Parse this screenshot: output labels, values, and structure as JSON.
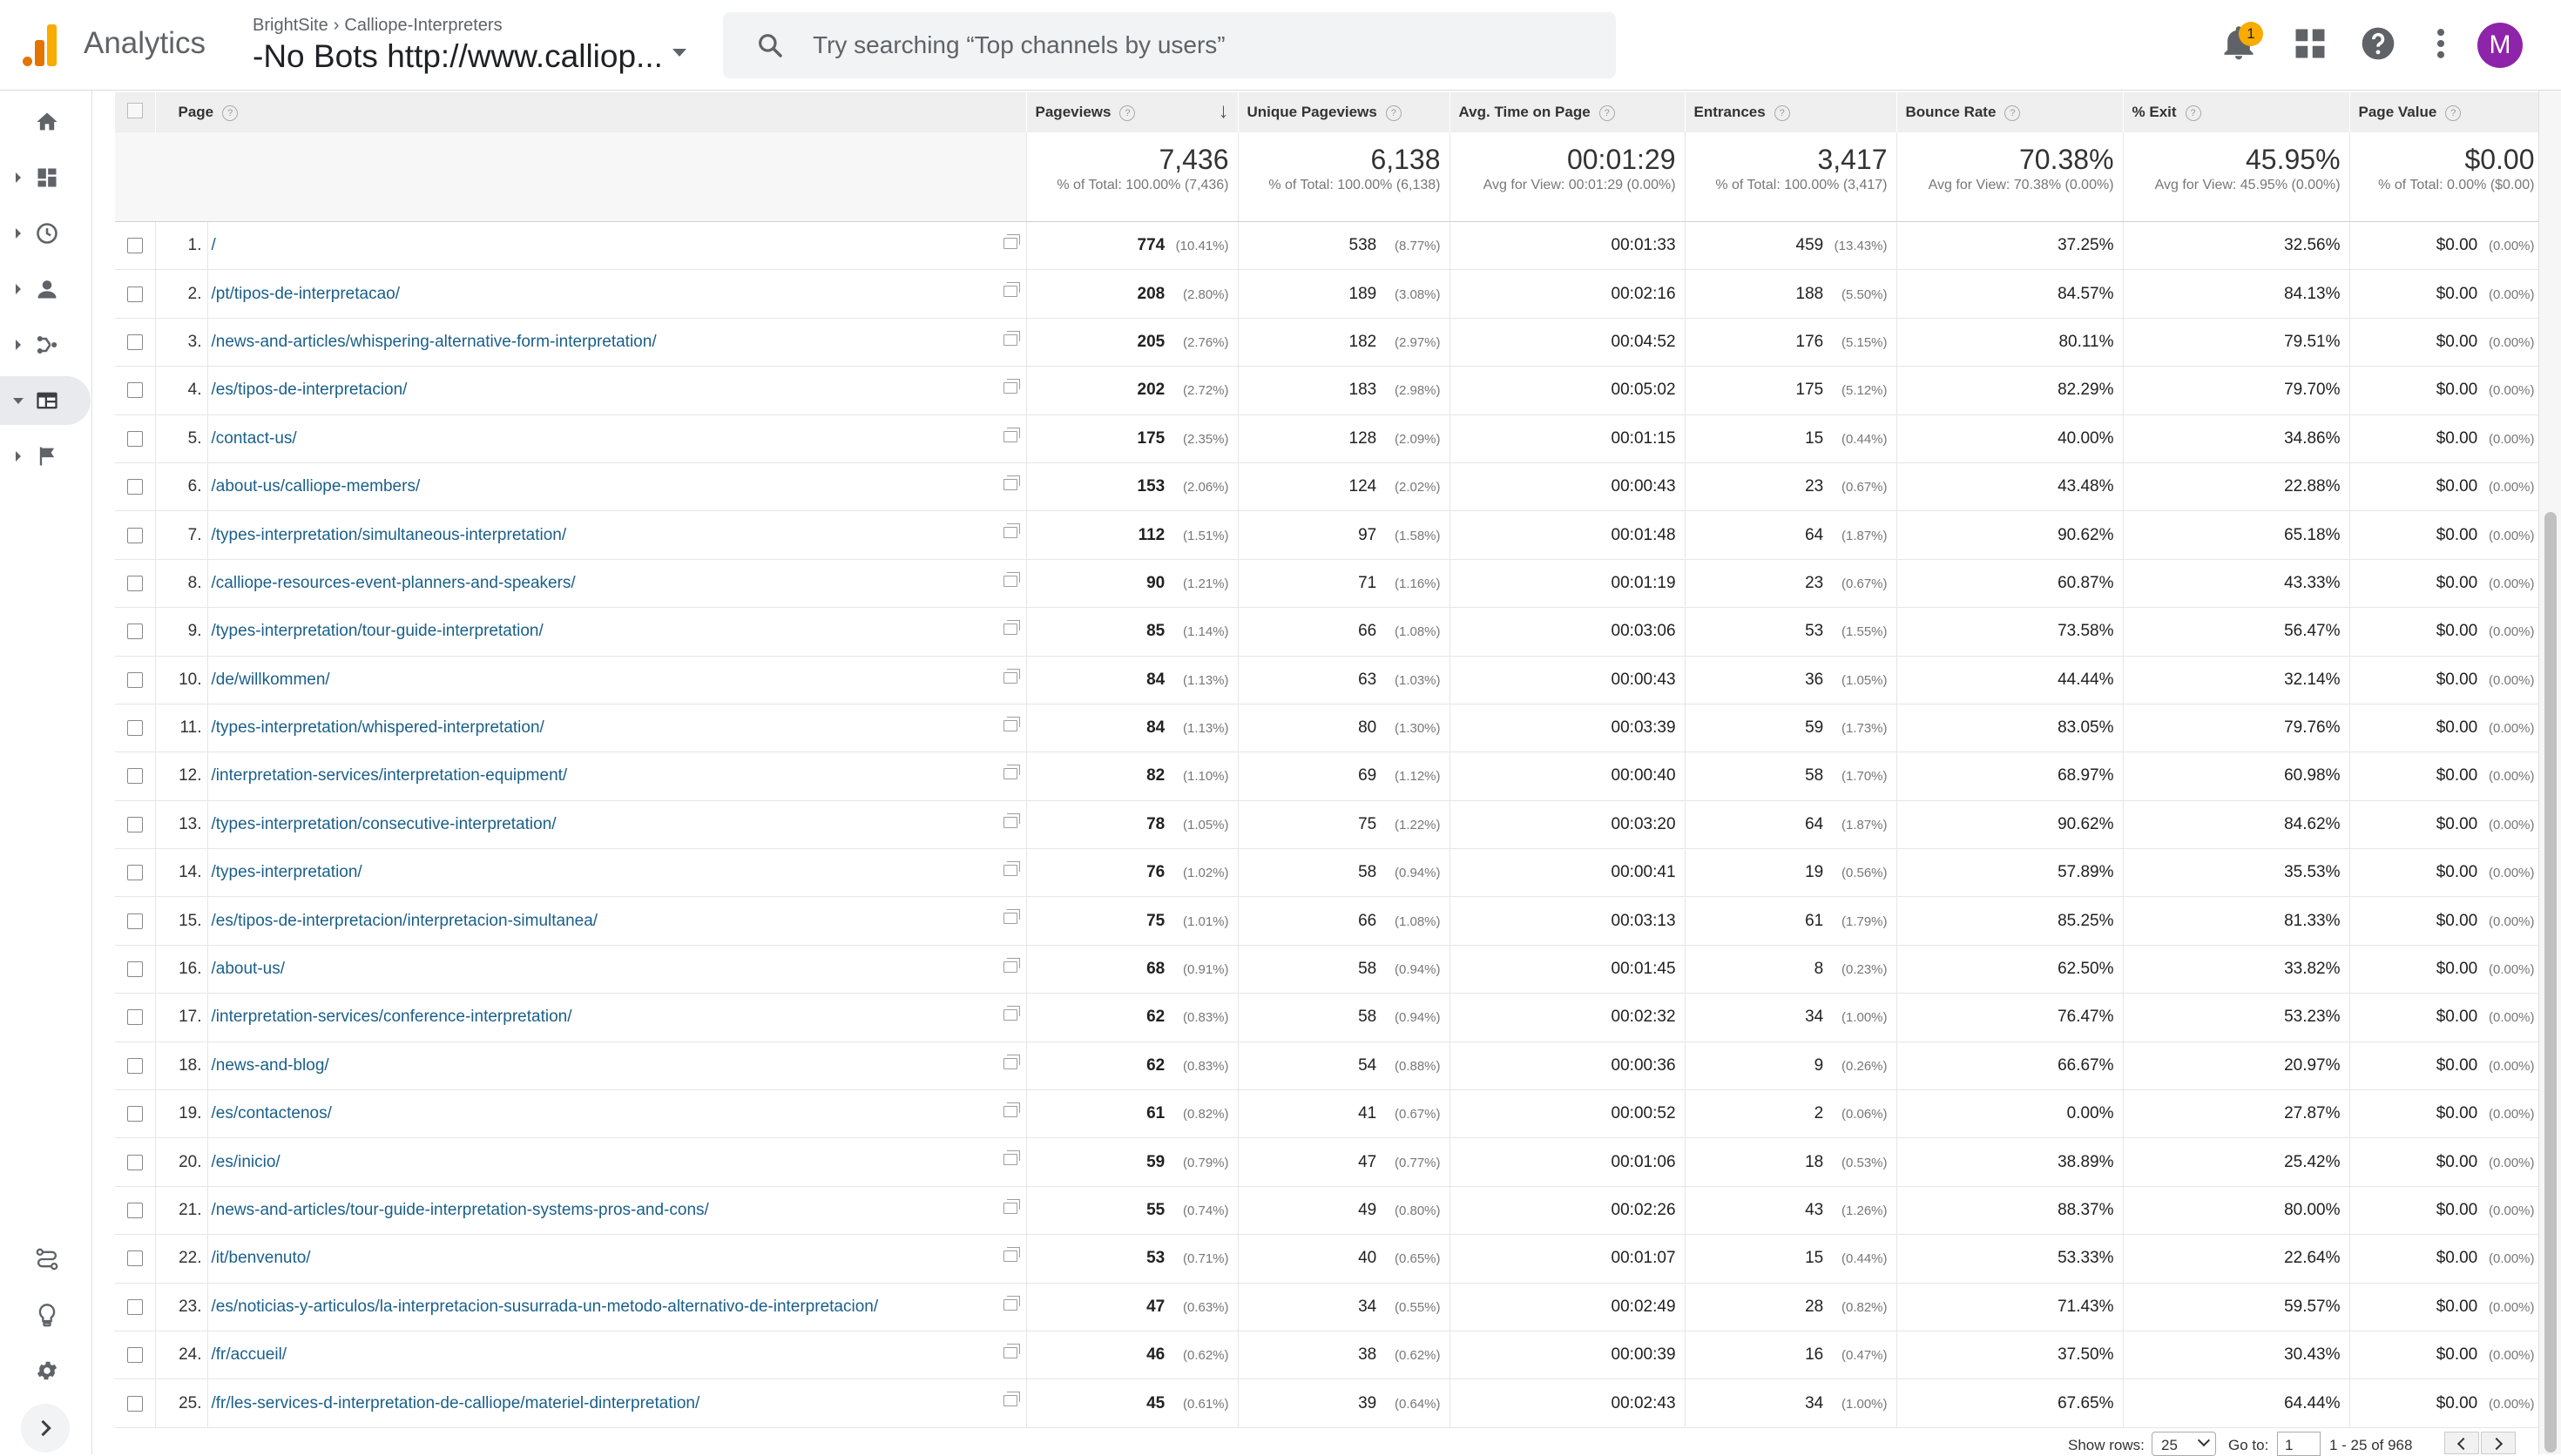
{
  "header": {
    "app_name": "Analytics",
    "account": "BrightSite",
    "property": "Calliope-Interpreters",
    "view": "-No Bots http://www.calliop...",
    "search_placeholder": "Try searching “Top channels by users”",
    "notification_count": "1",
    "avatar_letter": "M"
  },
  "columns": {
    "page": "Page",
    "pageviews": "Pageviews",
    "unique_pageviews": "Unique Pageviews",
    "avg_time": "Avg. Time on Page",
    "entrances": "Entrances",
    "bounce_rate": "Bounce Rate",
    "exit": "% Exit",
    "page_value": "Page Value",
    "help": "?"
  },
  "totals": {
    "pageviews": "7,436",
    "pageviews_sub": "% of Total: 100.00% (7,436)",
    "unique": "6,138",
    "unique_sub": "% of Total: 100.00% (6,138)",
    "avg_time": "00:01:29",
    "avg_time_sub": "Avg for View: 00:01:29 (0.00%)",
    "entrances": "3,417",
    "entrances_sub": "% of Total: 100.00% (3,417)",
    "bounce": "70.38%",
    "bounce_sub": "Avg for View: 70.38% (0.00%)",
    "exit": "45.95%",
    "exit_sub": "Avg for View: 45.95% (0.00%)",
    "value": "$0.00",
    "value_sub": "% of Total: 0.00% ($0.00)"
  },
  "rows": [
    {
      "idx": "1.",
      "page": "/",
      "pv": "774",
      "pvp": "(10.41%)",
      "upv": "538",
      "upvp": "(8.77%)",
      "time": "00:01:33",
      "ent": "459",
      "entp": "(13.43%)",
      "br": "37.25%",
      "ex": "32.56%",
      "val": "$0.00",
      "valp": "(0.00%)"
    },
    {
      "idx": "2.",
      "page": "/pt/tipos-de-interpretacao/",
      "pv": "208",
      "pvp": "(2.80%)",
      "upv": "189",
      "upvp": "(3.08%)",
      "time": "00:02:16",
      "ent": "188",
      "entp": "(5.50%)",
      "br": "84.57%",
      "ex": "84.13%",
      "val": "$0.00",
      "valp": "(0.00%)"
    },
    {
      "idx": "3.",
      "page": "/news-and-articles/whispering-alternative-form-interpretation/",
      "pv": "205",
      "pvp": "(2.76%)",
      "upv": "182",
      "upvp": "(2.97%)",
      "time": "00:04:52",
      "ent": "176",
      "entp": "(5.15%)",
      "br": "80.11%",
      "ex": "79.51%",
      "val": "$0.00",
      "valp": "(0.00%)"
    },
    {
      "idx": "4.",
      "page": "/es/tipos-de-interpretacion/",
      "pv": "202",
      "pvp": "(2.72%)",
      "upv": "183",
      "upvp": "(2.98%)",
      "time": "00:05:02",
      "ent": "175",
      "entp": "(5.12%)",
      "br": "82.29%",
      "ex": "79.70%",
      "val": "$0.00",
      "valp": "(0.00%)"
    },
    {
      "idx": "5.",
      "page": "/contact-us/",
      "pv": "175",
      "pvp": "(2.35%)",
      "upv": "128",
      "upvp": "(2.09%)",
      "time": "00:01:15",
      "ent": "15",
      "entp": "(0.44%)",
      "br": "40.00%",
      "ex": "34.86%",
      "val": "$0.00",
      "valp": "(0.00%)"
    },
    {
      "idx": "6.",
      "page": "/about-us/calliope-members/",
      "pv": "153",
      "pvp": "(2.06%)",
      "upv": "124",
      "upvp": "(2.02%)",
      "time": "00:00:43",
      "ent": "23",
      "entp": "(0.67%)",
      "br": "43.48%",
      "ex": "22.88%",
      "val": "$0.00",
      "valp": "(0.00%)"
    },
    {
      "idx": "7.",
      "page": "/types-interpretation/simultaneous-interpretation/",
      "pv": "112",
      "pvp": "(1.51%)",
      "upv": "97",
      "upvp": "(1.58%)",
      "time": "00:01:48",
      "ent": "64",
      "entp": "(1.87%)",
      "br": "90.62%",
      "ex": "65.18%",
      "val": "$0.00",
      "valp": "(0.00%)"
    },
    {
      "idx": "8.",
      "page": "/calliope-resources-event-planners-and-speakers/",
      "pv": "90",
      "pvp": "(1.21%)",
      "upv": "71",
      "upvp": "(1.16%)",
      "time": "00:01:19",
      "ent": "23",
      "entp": "(0.67%)",
      "br": "60.87%",
      "ex": "43.33%",
      "val": "$0.00",
      "valp": "(0.00%)"
    },
    {
      "idx": "9.",
      "page": "/types-interpretation/tour-guide-interpretation/",
      "pv": "85",
      "pvp": "(1.14%)",
      "upv": "66",
      "upvp": "(1.08%)",
      "time": "00:03:06",
      "ent": "53",
      "entp": "(1.55%)",
      "br": "73.58%",
      "ex": "56.47%",
      "val": "$0.00",
      "valp": "(0.00%)"
    },
    {
      "idx": "10.",
      "page": "/de/willkommen/",
      "pv": "84",
      "pvp": "(1.13%)",
      "upv": "63",
      "upvp": "(1.03%)",
      "time": "00:00:43",
      "ent": "36",
      "entp": "(1.05%)",
      "br": "44.44%",
      "ex": "32.14%",
      "val": "$0.00",
      "valp": "(0.00%)"
    },
    {
      "idx": "11.",
      "page": "/types-interpretation/whispered-interpretation/",
      "pv": "84",
      "pvp": "(1.13%)",
      "upv": "80",
      "upvp": "(1.30%)",
      "time": "00:03:39",
      "ent": "59",
      "entp": "(1.73%)",
      "br": "83.05%",
      "ex": "79.76%",
      "val": "$0.00",
      "valp": "(0.00%)"
    },
    {
      "idx": "12.",
      "page": "/interpretation-services/interpretation-equipment/",
      "pv": "82",
      "pvp": "(1.10%)",
      "upv": "69",
      "upvp": "(1.12%)",
      "time": "00:00:40",
      "ent": "58",
      "entp": "(1.70%)",
      "br": "68.97%",
      "ex": "60.98%",
      "val": "$0.00",
      "valp": "(0.00%)"
    },
    {
      "idx": "13.",
      "page": "/types-interpretation/consecutive-interpretation/",
      "pv": "78",
      "pvp": "(1.05%)",
      "upv": "75",
      "upvp": "(1.22%)",
      "time": "00:03:20",
      "ent": "64",
      "entp": "(1.87%)",
      "br": "90.62%",
      "ex": "84.62%",
      "val": "$0.00",
      "valp": "(0.00%)"
    },
    {
      "idx": "14.",
      "page": "/types-interpretation/",
      "pv": "76",
      "pvp": "(1.02%)",
      "upv": "58",
      "upvp": "(0.94%)",
      "time": "00:00:41",
      "ent": "19",
      "entp": "(0.56%)",
      "br": "57.89%",
      "ex": "35.53%",
      "val": "$0.00",
      "valp": "(0.00%)"
    },
    {
      "idx": "15.",
      "page": "/es/tipos-de-interpretacion/interpretacion-simultanea/",
      "pv": "75",
      "pvp": "(1.01%)",
      "upv": "66",
      "upvp": "(1.08%)",
      "time": "00:03:13",
      "ent": "61",
      "entp": "(1.79%)",
      "br": "85.25%",
      "ex": "81.33%",
      "val": "$0.00",
      "valp": "(0.00%)"
    },
    {
      "idx": "16.",
      "page": "/about-us/",
      "pv": "68",
      "pvp": "(0.91%)",
      "upv": "58",
      "upvp": "(0.94%)",
      "time": "00:01:45",
      "ent": "8",
      "entp": "(0.23%)",
      "br": "62.50%",
      "ex": "33.82%",
      "val": "$0.00",
      "valp": "(0.00%)"
    },
    {
      "idx": "17.",
      "page": "/interpretation-services/conference-interpretation/",
      "pv": "62",
      "pvp": "(0.83%)",
      "upv": "58",
      "upvp": "(0.94%)",
      "time": "00:02:32",
      "ent": "34",
      "entp": "(1.00%)",
      "br": "76.47%",
      "ex": "53.23%",
      "val": "$0.00",
      "valp": "(0.00%)"
    },
    {
      "idx": "18.",
      "page": "/news-and-blog/",
      "pv": "62",
      "pvp": "(0.83%)",
      "upv": "54",
      "upvp": "(0.88%)",
      "time": "00:00:36",
      "ent": "9",
      "entp": "(0.26%)",
      "br": "66.67%",
      "ex": "20.97%",
      "val": "$0.00",
      "valp": "(0.00%)"
    },
    {
      "idx": "19.",
      "page": "/es/contactenos/",
      "pv": "61",
      "pvp": "(0.82%)",
      "upv": "41",
      "upvp": "(0.67%)",
      "time": "00:00:52",
      "ent": "2",
      "entp": "(0.06%)",
      "br": "0.00%",
      "ex": "27.87%",
      "val": "$0.00",
      "valp": "(0.00%)"
    },
    {
      "idx": "20.",
      "page": "/es/inicio/",
      "pv": "59",
      "pvp": "(0.79%)",
      "upv": "47",
      "upvp": "(0.77%)",
      "time": "00:01:06",
      "ent": "18",
      "entp": "(0.53%)",
      "br": "38.89%",
      "ex": "25.42%",
      "val": "$0.00",
      "valp": "(0.00%)"
    },
    {
      "idx": "21.",
      "page": "/news-and-articles/tour-guide-interpretation-systems-pros-and-cons/",
      "pv": "55",
      "pvp": "(0.74%)",
      "upv": "49",
      "upvp": "(0.80%)",
      "time": "00:02:26",
      "ent": "43",
      "entp": "(1.26%)",
      "br": "88.37%",
      "ex": "80.00%",
      "val": "$0.00",
      "valp": "(0.00%)"
    },
    {
      "idx": "22.",
      "page": "/it/benvenuto/",
      "pv": "53",
      "pvp": "(0.71%)",
      "upv": "40",
      "upvp": "(0.65%)",
      "time": "00:01:07",
      "ent": "15",
      "entp": "(0.44%)",
      "br": "53.33%",
      "ex": "22.64%",
      "val": "$0.00",
      "valp": "(0.00%)"
    },
    {
      "idx": "23.",
      "page": "/es/noticias-y-articulos/la-interpretacion-susurrada-un-metodo-alternativo-de-interpretacion/",
      "pv": "47",
      "pvp": "(0.63%)",
      "upv": "34",
      "upvp": "(0.55%)",
      "time": "00:02:49",
      "ent": "28",
      "entp": "(0.82%)",
      "br": "71.43%",
      "ex": "59.57%",
      "val": "$0.00",
      "valp": "(0.00%)"
    },
    {
      "idx": "24.",
      "page": "/fr/accueil/",
      "pv": "46",
      "pvp": "(0.62%)",
      "upv": "38",
      "upvp": "(0.62%)",
      "time": "00:00:39",
      "ent": "16",
      "entp": "(0.47%)",
      "br": "37.50%",
      "ex": "30.43%",
      "val": "$0.00",
      "valp": "(0.00%)"
    },
    {
      "idx": "25.",
      "page": "/fr/les-services-d-interpretation-de-calliope/materiel-dinterpretation/",
      "pv": "45",
      "pvp": "(0.61%)",
      "upv": "39",
      "upvp": "(0.64%)",
      "time": "00:02:43",
      "ent": "34",
      "entp": "(1.00%)",
      "br": "67.65%",
      "ex": "64.44%",
      "val": "$0.00",
      "valp": "(0.00%)"
    }
  ],
  "footer": {
    "show_rows_label": "Show rows:",
    "show_rows_value": "25",
    "goto_label": "Go to:",
    "goto_value": "1",
    "range": "1 - 25 of 968"
  },
  "colors": {
    "accent": "#f9ab00",
    "link": "#1a5f8a",
    "avatar": "#8e24aa"
  },
  "icons": {
    "rail": [
      "home-icon",
      "dashboard-icon",
      "clock-icon",
      "person-icon",
      "acquisition-icon",
      "behavior-icon",
      "flag-icon",
      "attribution-icon",
      "lightbulb-icon",
      "gear-icon",
      "chevron-right-icon"
    ],
    "header": [
      "search-icon",
      "bell-icon",
      "apps-grid-icon",
      "help-icon",
      "more-vert-icon"
    ]
  }
}
